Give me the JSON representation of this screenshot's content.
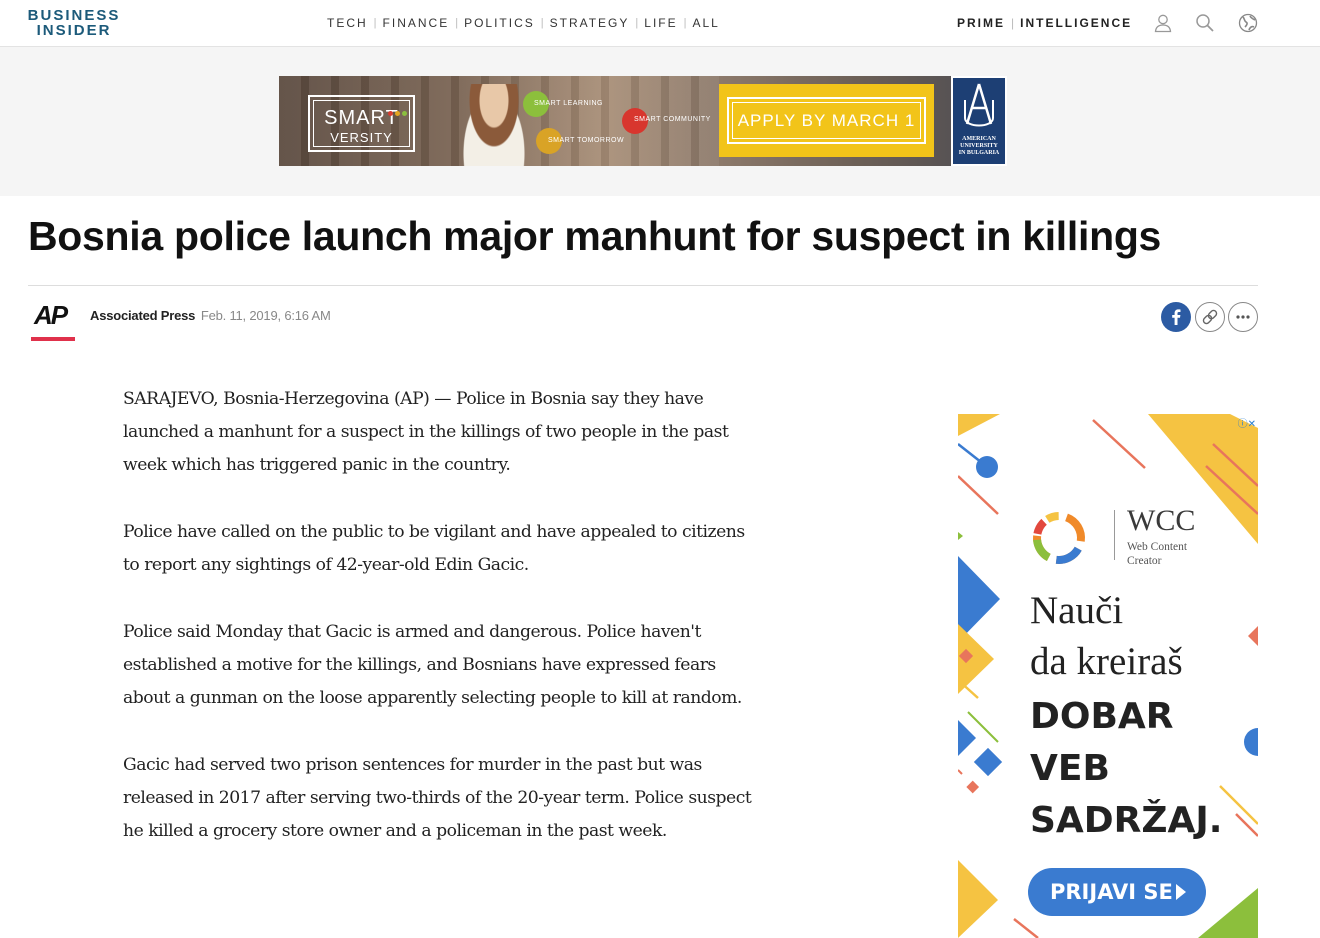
{
  "header": {
    "logo_line1": "BUSINESS",
    "logo_line2": "INSIDER",
    "nav": [
      "TECH",
      "FINANCE",
      "POLITICS",
      "STRATEGY",
      "LIFE",
      "ALL"
    ],
    "right_nav": [
      "PRIME",
      "INTELLIGENCE"
    ],
    "icons": [
      "user-icon",
      "search-icon",
      "globe-icon"
    ]
  },
  "banner_ad": {
    "brand_line1": "SMART",
    "brand_line2": "VERSITY",
    "bubbles": [
      "SMART LEARNING",
      "SMART COMMUNITY",
      "SMART TOMORROW"
    ],
    "cta": "APPLY BY MARCH 1",
    "university": [
      "AMERICAN",
      "UNIVERSITY",
      "IN BULGARIA"
    ]
  },
  "article": {
    "headline": "Bosnia police launch major manhunt for suspect in killings",
    "source_logo": "AP",
    "author": "Associated Press",
    "date": "Feb. 11, 2019, 6:16 AM",
    "share": [
      "facebook-icon",
      "link-icon",
      "more-icon"
    ],
    "paragraphs": [
      "SARAJEVO, Bosnia-Herzegovina (AP) — Police in Bosnia say they have launched a manhunt for a suspect in the killings of two people in the past week which has triggered panic in the country.",
      "Police have called on the public to be vigilant and have appealed to citizens to report any sightings of 42-year-old Edin Gacic.",
      "Police said Monday that Gacic is armed and dangerous. Police haven't established a motive for the killings, and Bosnians have expressed fears about a gunman on the loose apparently selecting people to kill at random.",
      "Gacic had served two prison sentences for murder in the past but was released in 2017 after serving two-thirds of the 20-year term. Police suspect he killed a grocery store owner and a policeman in the past week."
    ]
  },
  "side_ad": {
    "brand": "WCC",
    "brand_sub1": "Web Content",
    "brand_sub2": "Creator",
    "line1": "Nauči",
    "line2": "da kreiraš",
    "line3": "DOBAR",
    "line4": "VEB",
    "line5": "SADRŽAJ.",
    "cta": "PRIJAVI SE"
  },
  "colors": {
    "logo": "#1c5a7a",
    "ap_accent": "#e0314b",
    "facebook": "#2c5ba3",
    "ad_yellow": "#f2c419",
    "ad_blue": "#3a7bd0"
  }
}
